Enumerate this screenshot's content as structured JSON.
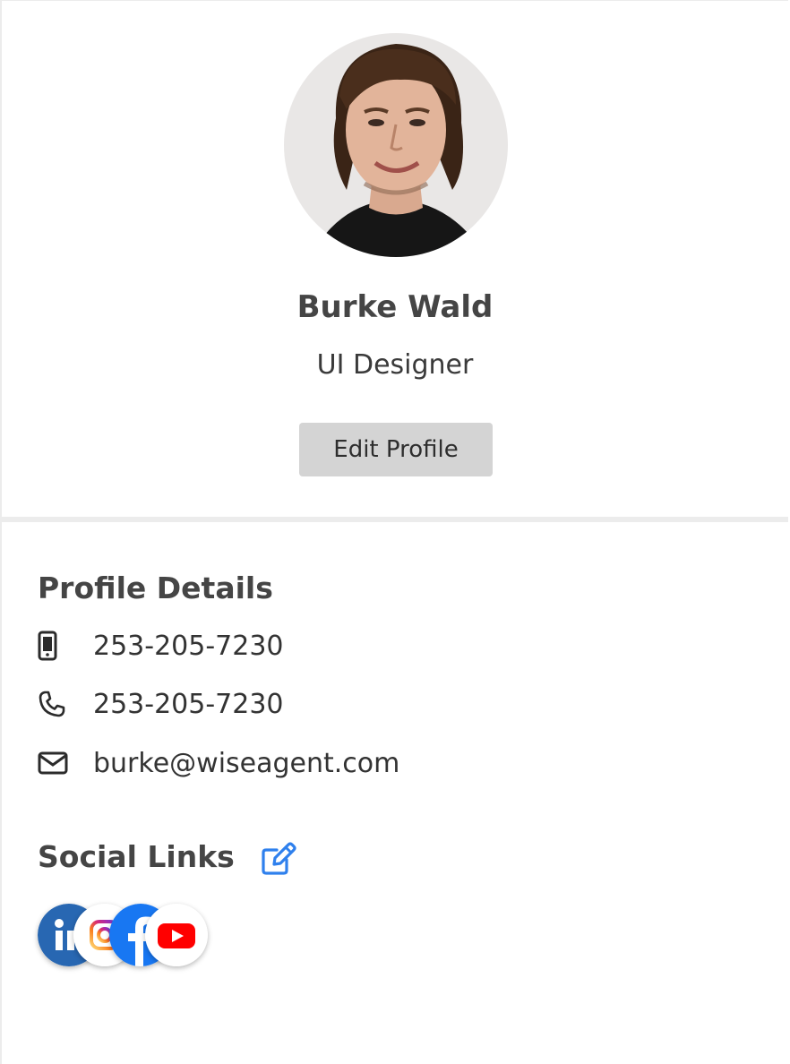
{
  "profile": {
    "name": "Burke Wald",
    "title": "UI Designer",
    "edit_label": "Edit Profile"
  },
  "details": {
    "heading": "Profile Details",
    "mobile": "253-205-7230",
    "phone": "253-205-7230",
    "email": "burke@wiseagent.com"
  },
  "social": {
    "heading": "Social Links",
    "icons": [
      "linkedin-icon",
      "instagram-icon",
      "facebook-icon",
      "youtube-icon"
    ]
  },
  "colors": {
    "accent": "#2f80ed",
    "linkedin": "#2867b2",
    "facebook": "#1877f2",
    "youtube": "#ff0000",
    "button_bg": "#d4d4d4"
  }
}
